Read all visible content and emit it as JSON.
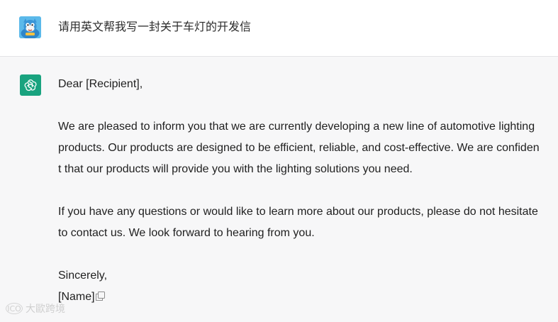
{
  "user": {
    "prompt": "请用英文帮我写一封关于车灯的开发信",
    "avatar_icon": "cartoon-user-avatar"
  },
  "assistant": {
    "avatar_icon": "chatgpt-logo-icon",
    "avatar_color": "#19a37f",
    "lines": [
      "Dear [Recipient],",
      "",
      "We are pleased to inform you that we are currently developing a new line of automotive lighting",
      "products. Our products are designed to be efficient, reliable, and cost-effective. We are confiden",
      "t that our products will provide you with the lighting solutions you need.",
      "",
      "If you have any questions or would like to learn more about our products, please do not hesitate",
      "to contact us. We look forward to hearing from you.",
      "",
      "Sincerely,",
      "[Name]"
    ],
    "copy_icon": "copy-icon"
  },
  "watermark": {
    "logo": "ICO",
    "text": "大歐跨境"
  }
}
